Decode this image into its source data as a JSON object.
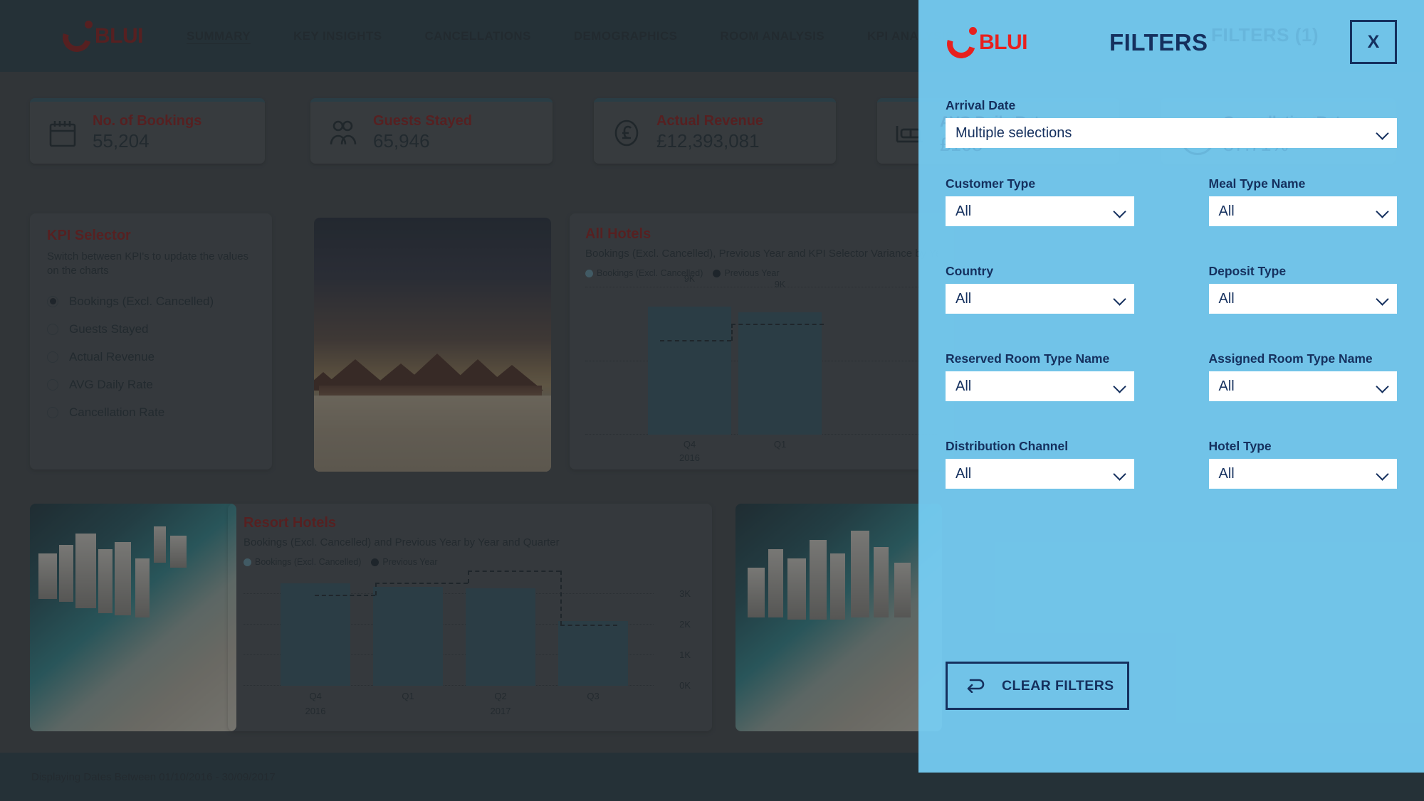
{
  "header": {
    "brand": "BLUI",
    "nav": [
      {
        "label": "SUMMARY",
        "active": true
      },
      {
        "label": "KEY INSIGHTS",
        "active": false
      },
      {
        "label": "CANCELLATIONS",
        "active": false
      },
      {
        "label": "DEMOGRAPHICS",
        "active": false
      },
      {
        "label": "ROOM ANALYSIS",
        "active": false
      },
      {
        "label": "KPI ANALYSIS",
        "active": false
      }
    ]
  },
  "kpi_cards": [
    {
      "icon": "calendar-icon",
      "title": "No. of Bookings",
      "value": "55,204"
    },
    {
      "icon": "guests-icon",
      "title": "Guests Stayed",
      "value": "65,946"
    },
    {
      "icon": "pound-icon",
      "title": "Actual Revenue",
      "value": "£12,393,081"
    },
    {
      "icon": "bed-icon",
      "title": "AVG Daily Rate",
      "value": "£108"
    },
    {
      "icon": "cancel-icon",
      "title": "Cancellation Rate",
      "value": "37.71%"
    }
  ],
  "kpi_selector": {
    "title": "KPI Selector",
    "subtitle": "Switch between KPI's to update the values on the charts",
    "options": [
      {
        "label": "Bookings (Excl. Cancelled)",
        "selected": true
      },
      {
        "label": "Guests Stayed",
        "selected": false
      },
      {
        "label": "Actual Revenue",
        "selected": false
      },
      {
        "label": "AVG Daily Rate",
        "selected": false
      },
      {
        "label": "Cancellation Rate",
        "selected": false
      }
    ]
  },
  "footer": {
    "text": "Displaying Dates Between 01/10/2016 - 30/09/2017"
  },
  "filters": {
    "brand": "BLUI",
    "title": "FILTERS",
    "ghost_badge": "FILTERS (1)",
    "close_label": "X",
    "arrival": {
      "label": "Arrival Date",
      "value": "Multiple selections"
    },
    "fields": [
      {
        "label": "Customer Type",
        "value": "All"
      },
      {
        "label": "Meal Type Name",
        "value": "All"
      },
      {
        "label": "Country",
        "value": "All"
      },
      {
        "label": "Deposit Type",
        "value": "All"
      },
      {
        "label": "Reserved Room Type Name",
        "value": "All"
      },
      {
        "label": "Assigned Room Type Name",
        "value": "All"
      },
      {
        "label": "Distribution Channel",
        "value": "All"
      },
      {
        "label": "Hotel Type",
        "value": "All"
      }
    ],
    "clear_label": "CLEAR FILTERS"
  },
  "colors": {
    "accent_red": "#8f1616",
    "logo_red": "#e8201e",
    "header_bg": "#233b46",
    "filter_bg": "#76cff5",
    "filter_ink": "#15305e",
    "bar": "#2f5465"
  },
  "chart_data": [
    {
      "id": "all_hotels",
      "type": "bar",
      "title": "All Hotels",
      "subtitle": "Bookings (Excl. Cancelled), Previous Year and KPI Selector Variance by Year and Quarter",
      "legend": [
        "Bookings (Excl. Cancelled)",
        "Previous Year"
      ],
      "legend_position": "top-left",
      "categories": [
        "Q4",
        "Q1"
      ],
      "category_years": [
        "2016",
        ""
      ],
      "series": [
        {
          "name": "Bookings (Excl. Cancelled)",
          "values": [
            9000,
            9000
          ],
          "labels": [
            "9K",
            "9K"
          ]
        },
        {
          "name": "Previous Year",
          "values": [
            6500,
            7100
          ]
        }
      ],
      "xlabel": "",
      "ylabel": "",
      "ylim": [
        0,
        10000
      ],
      "grid": true
    },
    {
      "id": "resort_hotels",
      "type": "bar",
      "title": "Resort Hotels",
      "subtitle": "Bookings (Excl. Cancelled) and Previous Year by Year and Quarter",
      "legend": [
        "Bookings (Excl. Cancelled)",
        "Previous Year"
      ],
      "legend_position": "top-left",
      "categories": [
        "Q4",
        "Q1",
        "Q2",
        "Q3"
      ],
      "category_years": [
        "2016",
        "",
        "2017",
        ""
      ],
      "ytick_labels": [
        "0K",
        "1K",
        "2K",
        "3K"
      ],
      "ytick_values": [
        0,
        1000,
        2000,
        3000
      ],
      "series": [
        {
          "name": "Bookings (Excl. Cancelled)",
          "values": [
            3350,
            3250,
            3200,
            2120
          ]
        },
        {
          "name": "Previous Year",
          "values": [
            2950,
            3150,
            3500,
            2050
          ]
        }
      ],
      "xlabel": "",
      "ylabel": "",
      "ylim": [
        0,
        4000
      ],
      "grid": true
    }
  ]
}
